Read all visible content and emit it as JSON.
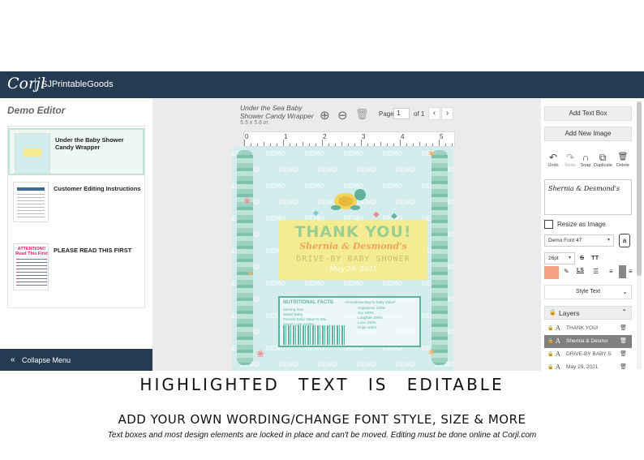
{
  "app": {
    "logo": "Corjl",
    "shop_name": "SJPrintableGoods"
  },
  "sidebar": {
    "title": "Demo Editor",
    "pages": [
      {
        "label": "Under the Baby Shower Candy Wrapper",
        "active": true
      },
      {
        "label": "Customer Editing Instructions",
        "active": false
      },
      {
        "label": "PLEASE READ THIS FIRST",
        "active": false
      }
    ],
    "collapse_label": "Collapse Menu",
    "attention_text": "ATTENTION!! Read This First"
  },
  "workspace": {
    "doc_title_line1": "Under the Sea Baby",
    "doc_title_line2": "Shower Candy Wrapper",
    "doc_size": "5.5 x 5.6 in",
    "page_label": "Page",
    "page_value": "1",
    "of_label": "of 1",
    "ruler_numbers": [
      "0",
      "1",
      "2",
      "3",
      "4",
      "5"
    ]
  },
  "design": {
    "thank_you": "THANK YOU!",
    "names": "Shernia & Desmond's",
    "event": "DRIVE-BY BABY SHOWER",
    "date": "May 29, 2021",
    "watermark": "DEMO",
    "nutrition_title": "NUTRITIONAL FACTS",
    "nutrition_right": "Amount/Serving % Daily Value*",
    "nutrition_left": [
      "Serving Size",
      "Sweet Baby",
      "Percent Daily Value % Dai",
      "Sweet Love Smiles"
    ],
    "nutrition_values": [
      "Happiness 100%",
      "Joy 100%",
      "Laughter 100%",
      "Love 100%",
      "Hugs 100%"
    ]
  },
  "rightpanel": {
    "add_text_box": "Add Text Box",
    "add_new_image": "Add New Image",
    "actions": [
      {
        "icon": "↶",
        "label": "Undo",
        "enabled": true
      },
      {
        "icon": "↷",
        "label": "Redo",
        "enabled": false
      },
      {
        "icon": "∩",
        "label": "Snap",
        "enabled": true
      },
      {
        "icon": "⧉",
        "label": "Duplicate",
        "enabled": true
      },
      {
        "icon": "🗑",
        "label": "Delete",
        "enabled": true
      }
    ],
    "text_value": "Shernia & Desmond's",
    "resize_as_image": "Resize as Image",
    "font_select": "Demo Font 47",
    "font_size": "26pt",
    "color_swatch": "#f6a183",
    "style_text": "Style Text",
    "layers_title": "Layers",
    "layers": [
      {
        "name": "THANK YOU!",
        "selected": false
      },
      {
        "name": "Shernia & Desmo",
        "selected": true
      },
      {
        "name": "DRIVE-BY BABY S",
        "selected": false
      },
      {
        "name": "May 29, 2021",
        "selected": false
      }
    ]
  },
  "captions": {
    "line1": "HIGHLIGHTED TEXT IS EDITABLE",
    "line2": "ADD YOUR OWN WORDING/CHANGE FONT STYLE, SIZE & MORE",
    "line3": "Text boxes and most design elements are locked in place and can't be moved. Editing must be done online at Corjl.com"
  },
  "colors": {
    "topbar": "#253b52",
    "accent": "#f6a183",
    "highlight": "#f4ec8e",
    "canvas": "#d3ecec"
  }
}
